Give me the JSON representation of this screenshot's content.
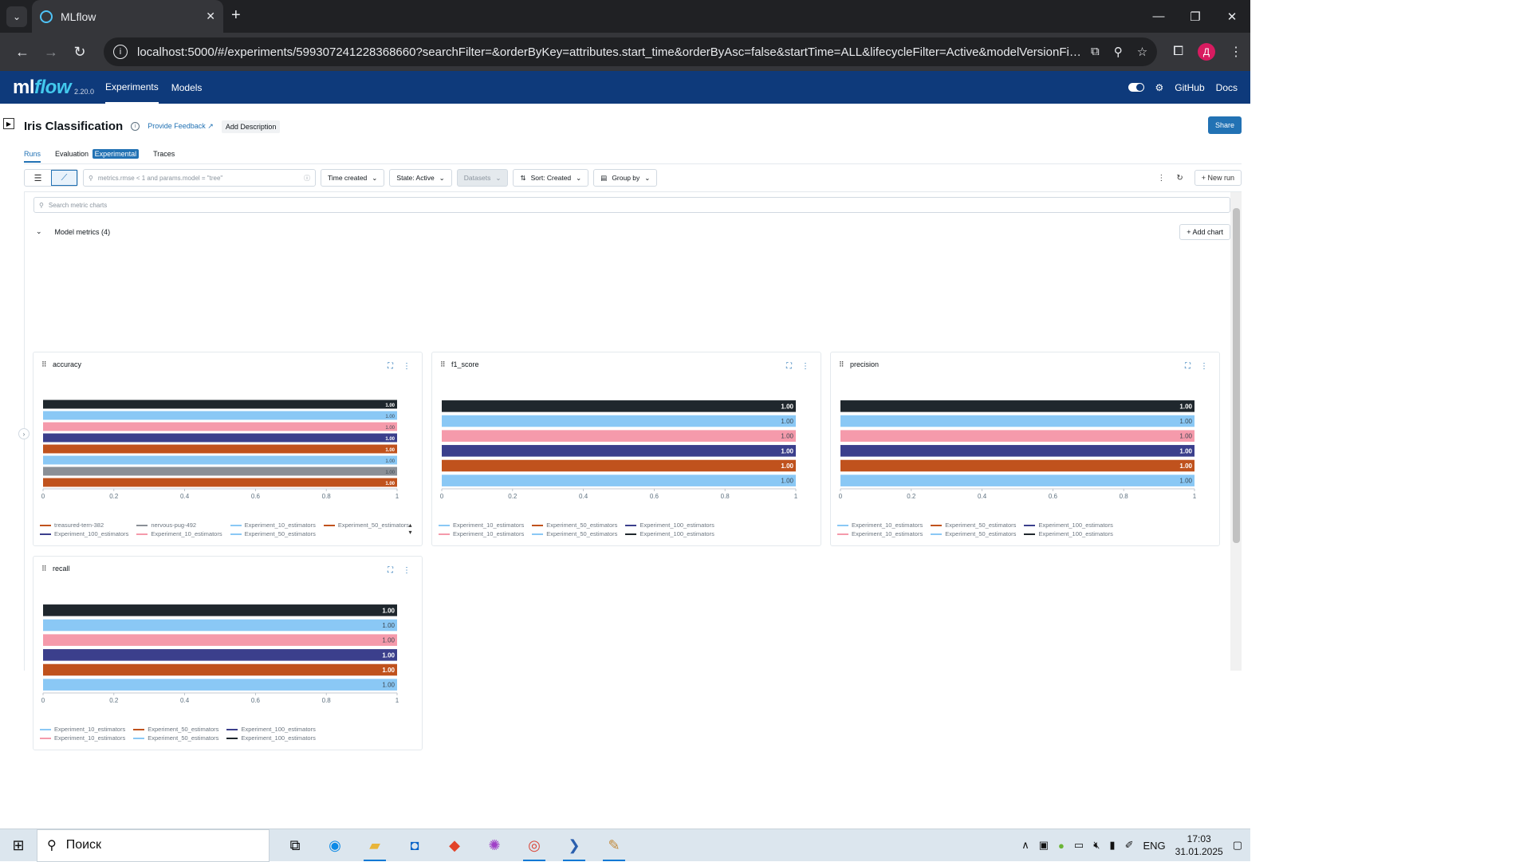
{
  "browser": {
    "tab_title": "MLflow",
    "url": "localhost:5000/#/experiments/599307241228368660?searchFilter=&orderByKey=attributes.start_time&orderByAsc=false&startTime=ALL&lifecycleFilter=Active&modelVersionFilter=...",
    "avatar_letter": "Д"
  },
  "header": {
    "logo_ml": "ml",
    "logo_flow": "flow",
    "version": "2.20.0",
    "nav": [
      "Experiments",
      "Models"
    ],
    "github": "GitHub",
    "docs": "Docs"
  },
  "page": {
    "title": "Iris Classification",
    "feedback": "Provide Feedback",
    "add_description": "Add Description",
    "share": "Share",
    "tabs": [
      "Runs",
      "Evaluation",
      "Traces"
    ],
    "experimental_badge": "Experimental"
  },
  "toolbar": {
    "search_placeholder": "metrics.rmse < 1 and params.model = \"tree\"",
    "time_created": "Time created",
    "state": "State: Active",
    "datasets": "Datasets",
    "sort": "Sort: Created",
    "group_by": "Group by",
    "new_run": "New run"
  },
  "charts_panel": {
    "search_placeholder": "Search metric charts",
    "section_title": "Model metrics (4)",
    "add_chart": "Add chart"
  },
  "chart_data": [
    {
      "type": "bar",
      "title": "accuracy",
      "orientation": "horizontal",
      "xlim": [
        0,
        1
      ],
      "xticks": [
        "0",
        "0.2",
        "0.4",
        "0.6",
        "0.8",
        "1"
      ],
      "bars": [
        {
          "value": 1.0,
          "label": "1.00",
          "color": "#1f272d"
        },
        {
          "value": 1.0,
          "label": "1.00",
          "color": "#8ac8f5"
        },
        {
          "value": 1.0,
          "label": "1.00",
          "color": "#f59aab"
        },
        {
          "value": 1.0,
          "label": "1.00",
          "color": "#3b3f8c"
        },
        {
          "value": 1.0,
          "label": "1.00",
          "color": "#c0521d"
        },
        {
          "value": 1.0,
          "label": "1.00",
          "color": "#8ac8f5"
        },
        {
          "value": 1.0,
          "label": "1.00",
          "color": "#8a8f96"
        },
        {
          "value": 1.0,
          "label": "1.00",
          "color": "#c0521d"
        }
      ],
      "legend": [
        {
          "name": "treasured-tern-382",
          "color": "#c0521d"
        },
        {
          "name": "nervous-pug-492",
          "color": "#8a8f96"
        },
        {
          "name": "Experiment_10_estimators",
          "color": "#8ac8f5"
        },
        {
          "name": "Experiment_50_estimators",
          "color": "#c0521d"
        },
        {
          "name": "Experiment_100_estimators",
          "color": "#3b3f8c"
        },
        {
          "name": "Experiment_10_estimators",
          "color": "#f59aab"
        },
        {
          "name": "Experiment_50_estimators",
          "color": "#8ac8f5"
        }
      ]
    },
    {
      "type": "bar",
      "title": "f1_score",
      "orientation": "horizontal",
      "xlim": [
        0,
        1
      ],
      "xticks": [
        "0",
        "0.2",
        "0.4",
        "0.6",
        "0.8",
        "1"
      ],
      "bars": [
        {
          "value": 1.0,
          "label": "1.00",
          "color": "#1f272d"
        },
        {
          "value": 1.0,
          "label": "1.00",
          "color": "#8ac8f5"
        },
        {
          "value": 1.0,
          "label": "1.00",
          "color": "#f59aab"
        },
        {
          "value": 1.0,
          "label": "1.00",
          "color": "#3b3f8c"
        },
        {
          "value": 1.0,
          "label": "1.00",
          "color": "#c0521d"
        },
        {
          "value": 1.0,
          "label": "1.00",
          "color": "#8ac8f5"
        }
      ],
      "legend": [
        {
          "name": "Experiment_10_estimators",
          "color": "#8ac8f5"
        },
        {
          "name": "Experiment_50_estimators",
          "color": "#c0521d"
        },
        {
          "name": "Experiment_100_estimators",
          "color": "#3b3f8c"
        },
        {
          "name": "Experiment_10_estimators",
          "color": "#f59aab"
        },
        {
          "name": "Experiment_50_estimators",
          "color": "#8ac8f5"
        },
        {
          "name": "Experiment_100_estimators",
          "color": "#1f272d"
        }
      ]
    },
    {
      "type": "bar",
      "title": "precision",
      "orientation": "horizontal",
      "xlim": [
        0,
        1
      ],
      "xticks": [
        "0",
        "0.2",
        "0.4",
        "0.6",
        "0.8",
        "1"
      ],
      "bars": [
        {
          "value": 1.0,
          "label": "1.00",
          "color": "#1f272d"
        },
        {
          "value": 1.0,
          "label": "1.00",
          "color": "#8ac8f5"
        },
        {
          "value": 1.0,
          "label": "1.00",
          "color": "#f59aab"
        },
        {
          "value": 1.0,
          "label": "1.00",
          "color": "#3b3f8c"
        },
        {
          "value": 1.0,
          "label": "1.00",
          "color": "#c0521d"
        },
        {
          "value": 1.0,
          "label": "1.00",
          "color": "#8ac8f5"
        }
      ],
      "legend": [
        {
          "name": "Experiment_10_estimators",
          "color": "#8ac8f5"
        },
        {
          "name": "Experiment_50_estimators",
          "color": "#c0521d"
        },
        {
          "name": "Experiment_100_estimators",
          "color": "#3b3f8c"
        },
        {
          "name": "Experiment_10_estimators",
          "color": "#f59aab"
        },
        {
          "name": "Experiment_50_estimators",
          "color": "#8ac8f5"
        },
        {
          "name": "Experiment_100_estimators",
          "color": "#1f272d"
        }
      ]
    },
    {
      "type": "bar",
      "title": "recall",
      "orientation": "horizontal",
      "xlim": [
        0,
        1
      ],
      "xticks": [
        "0",
        "0.2",
        "0.4",
        "0.6",
        "0.8",
        "1"
      ],
      "bars": [
        {
          "value": 1.0,
          "label": "1.00",
          "color": "#1f272d"
        },
        {
          "value": 1.0,
          "label": "1.00",
          "color": "#8ac8f5"
        },
        {
          "value": 1.0,
          "label": "1.00",
          "color": "#f59aab"
        },
        {
          "value": 1.0,
          "label": "1.00",
          "color": "#3b3f8c"
        },
        {
          "value": 1.0,
          "label": "1.00",
          "color": "#c0521d"
        },
        {
          "value": 1.0,
          "label": "1.00",
          "color": "#8ac8f5"
        }
      ],
      "legend": [
        {
          "name": "Experiment_10_estimators",
          "color": "#8ac8f5"
        },
        {
          "name": "Experiment_50_estimators",
          "color": "#c0521d"
        },
        {
          "name": "Experiment_100_estimators",
          "color": "#3b3f8c"
        },
        {
          "name": "Experiment_10_estimators",
          "color": "#f59aab"
        },
        {
          "name": "Experiment_50_estimators",
          "color": "#8ac8f5"
        },
        {
          "name": "Experiment_100_estimators",
          "color": "#1f272d"
        }
      ]
    }
  ],
  "taskbar": {
    "search_text": "Поиск",
    "language": "ENG",
    "time": "17:03",
    "date": "31.01.2025"
  }
}
